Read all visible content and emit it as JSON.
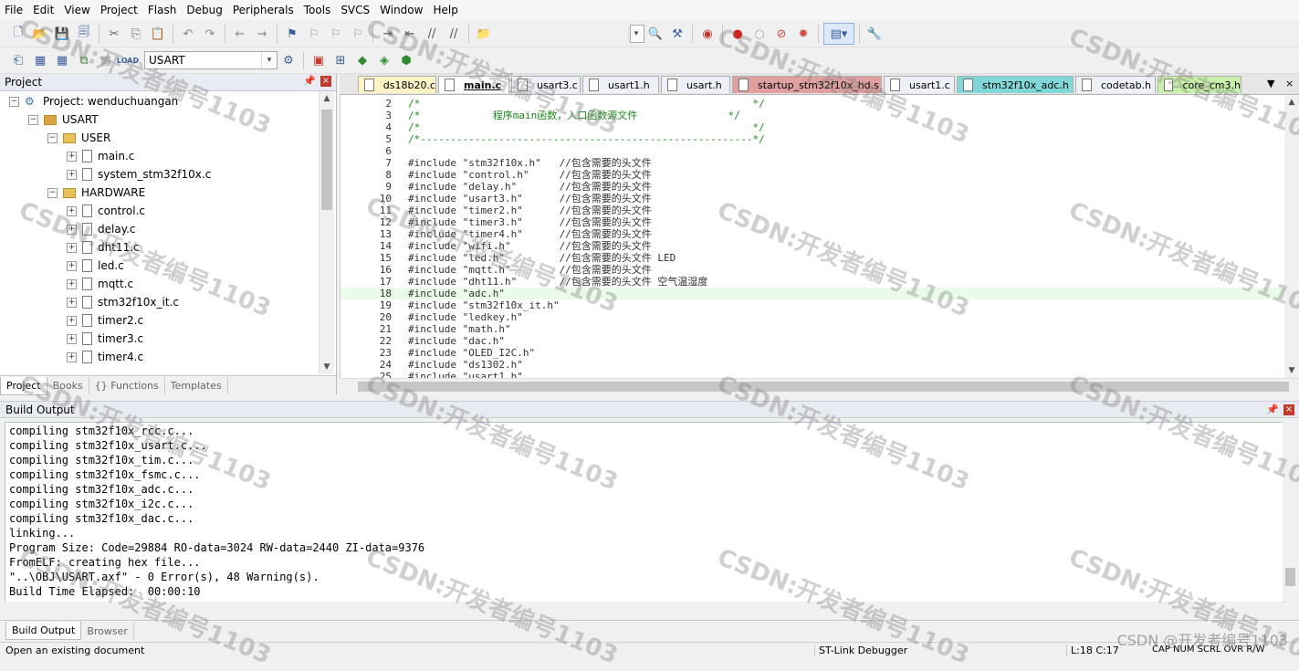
{
  "menu": [
    "File",
    "Edit",
    "View",
    "Project",
    "Flash",
    "Debug",
    "Peripherals",
    "Tools",
    "SVCS",
    "Window",
    "Help"
  ],
  "toolbar": {
    "target_name": "USART"
  },
  "project_panel": {
    "title": "Project",
    "tree": [
      {
        "label": "Project: wenduchuangan",
        "indent": 0,
        "type": "project",
        "expander": "-"
      },
      {
        "label": "USART",
        "indent": 1,
        "type": "target",
        "expander": "-"
      },
      {
        "label": "USER",
        "indent": 2,
        "type": "folder",
        "expander": "-"
      },
      {
        "label": "main.c",
        "indent": 3,
        "type": "file",
        "expander": "+"
      },
      {
        "label": "system_stm32f10x.c",
        "indent": 3,
        "type": "file",
        "expander": "+"
      },
      {
        "label": "HARDWARE",
        "indent": 2,
        "type": "folder",
        "expander": "-"
      },
      {
        "label": "control.c",
        "indent": 3,
        "type": "file",
        "expander": "+"
      },
      {
        "label": "delay.c",
        "indent": 3,
        "type": "file",
        "expander": "+"
      },
      {
        "label": "dht11.c",
        "indent": 3,
        "type": "file",
        "expander": "+"
      },
      {
        "label": "led.c",
        "indent": 3,
        "type": "file",
        "expander": "+"
      },
      {
        "label": "mqtt.c",
        "indent": 3,
        "type": "file",
        "expander": "+"
      },
      {
        "label": "stm32f10x_it.c",
        "indent": 3,
        "type": "file",
        "expander": "+"
      },
      {
        "label": "timer2.c",
        "indent": 3,
        "type": "file",
        "expander": "+"
      },
      {
        "label": "timer3.c",
        "indent": 3,
        "type": "file",
        "expander": "+"
      },
      {
        "label": "timer4.c",
        "indent": 3,
        "type": "file",
        "expander": "+"
      }
    ],
    "tabs": [
      {
        "label": "Project",
        "active": true
      },
      {
        "label": "Books",
        "active": false
      },
      {
        "label": "{} Functions",
        "active": false
      },
      {
        "label": "Templates",
        "active": false
      }
    ]
  },
  "editor": {
    "tabs": [
      {
        "label": "ds18b20.c",
        "color": "#fdf3c4",
        "active": false
      },
      {
        "label": "main.c",
        "color": "#ffffff",
        "active": true
      },
      {
        "label": "usart3.c",
        "color": "#eef0f8",
        "active": false
      },
      {
        "label": "usart1.h",
        "color": "#eef0f8",
        "active": false
      },
      {
        "label": "usart.h",
        "color": "#eef0f8",
        "active": false
      },
      {
        "label": "startup_stm32f10x_hd.s",
        "color": "#e0a0a0",
        "active": false
      },
      {
        "label": "usart1.c",
        "color": "#eef0f8",
        "active": false
      },
      {
        "label": "stm32f10x_adc.h",
        "color": "#7fd7d7",
        "active": false
      },
      {
        "label": "codetab.h",
        "color": "#eef0f8",
        "active": false
      },
      {
        "label": "core_cm3.h",
        "color": "#c8f0a8",
        "active": false
      }
    ],
    "highlight_line": 18,
    "lines": [
      {
        "n": "2",
        "code": "/*                                                       */"
      },
      {
        "n": "3",
        "code": "/*            程序main函数，入口函数源文件               */"
      },
      {
        "n": "4",
        "code": "/*                                                       */"
      },
      {
        "n": "5",
        "code": "/*-------------------------------------------------------*/"
      },
      {
        "n": "6",
        "code": ""
      },
      {
        "n": "7",
        "code": "#include \"stm32f10x.h\"   //包含需要的头文件"
      },
      {
        "n": "8",
        "code": "#include \"control.h\"     //包含需要的头文件"
      },
      {
        "n": "9",
        "code": "#include \"delay.h\"       //包含需要的头文件"
      },
      {
        "n": "10",
        "code": "#include \"usart3.h\"      //包含需要的头文件"
      },
      {
        "n": "11",
        "code": "#include \"timer2.h\"      //包含需要的头文件"
      },
      {
        "n": "12",
        "code": "#include \"timer3.h\"      //包含需要的头文件"
      },
      {
        "n": "13",
        "code": "#include \"timer4.h\"      //包含需要的头文件"
      },
      {
        "n": "14",
        "code": "#include \"wifi.h\"        //包含需要的头文件"
      },
      {
        "n": "15",
        "code": "#include \"led.h\"         //包含需要的头文件 LED"
      },
      {
        "n": "16",
        "code": "#include \"mqtt.h\"        //包含需要的头文件"
      },
      {
        "n": "17",
        "code": "#include \"dht11.h\"       //包含需要的头文件 空气温湿度"
      },
      {
        "n": "18",
        "code": "#include \"adc.h\""
      },
      {
        "n": "19",
        "code": "#include \"stm32f10x_it.h\""
      },
      {
        "n": "20",
        "code": "#include \"ledkey.h\""
      },
      {
        "n": "21",
        "code": "#include \"math.h\""
      },
      {
        "n": "22",
        "code": "#include \"dac.h\""
      },
      {
        "n": "23",
        "code": "#include \"OLED_I2C.h\""
      },
      {
        "n": "24",
        "code": "#include \"ds1302.h\""
      },
      {
        "n": "25",
        "code": "#include \"usart1.h\""
      }
    ]
  },
  "build": {
    "title": "Build Output",
    "lines": [
      "compiling stm32f10x_rcc.c...",
      "compiling stm32f10x_usart.c...",
      "compiling stm32f10x_tim.c...",
      "compiling stm32f10x_fsmc.c...",
      "compiling stm32f10x_adc.c...",
      "compiling stm32f10x_i2c.c...",
      "compiling stm32f10x_dac.c...",
      "linking...",
      "Program Size: Code=29884 RO-data=3024 RW-data=2440 ZI-data=9376",
      "FromELF: creating hex file...",
      "\"..\\OBJ\\USART.axf\" - 0 Error(s), 48 Warning(s).",
      "Build Time Elapsed:  00:00:10"
    ],
    "tabs": [
      {
        "label": "Build Output",
        "active": true
      },
      {
        "label": "Browser",
        "active": false
      }
    ]
  },
  "status": {
    "message": "Open an existing document",
    "debugger": "ST-Link Debugger",
    "position": "L:18 C:17",
    "indicators": "CAP  NUM  SCRL  OVR  R/W"
  },
  "watermark": {
    "text": "CSDN:开发者编号1103",
    "corner": "CSDN @开发者编号1103"
  }
}
